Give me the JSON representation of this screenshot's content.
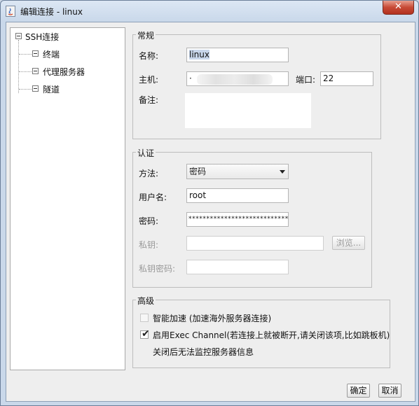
{
  "window": {
    "title": "编辑连接 - linux",
    "close_label": "✕"
  },
  "tree": {
    "root": "SSH连接",
    "children": [
      "终端",
      "代理服务器",
      "隧道"
    ]
  },
  "general": {
    "title": "常规",
    "name_label": "名称:",
    "name_value": "linux",
    "host_label": "主机:",
    "host_value": "·",
    "port_label": "端口:",
    "port_value": "22",
    "note_label": "备注:",
    "note_value": ""
  },
  "auth": {
    "title": "认证",
    "method_label": "方法:",
    "method_value": "密码",
    "user_label": "用户名:",
    "user_value": "root",
    "password_label": "密码:",
    "password_value": "****************************",
    "key_label": "私钥:",
    "key_value": "",
    "browse_label": "浏览...",
    "key_password_label": "私钥密码:",
    "key_password_value": ""
  },
  "advanced": {
    "title": "高级",
    "accel_label": "智能加速 (加速海外服务器连接)",
    "exec_label": "启用Exec Channel(若连接上就被断开,请关闭该项,比如跳板机)",
    "exec_note": "关闭后无法监控服务器信息",
    "exec_checked": true,
    "accel_checked": false
  },
  "buttons": {
    "ok": "确定",
    "cancel": "取消"
  }
}
